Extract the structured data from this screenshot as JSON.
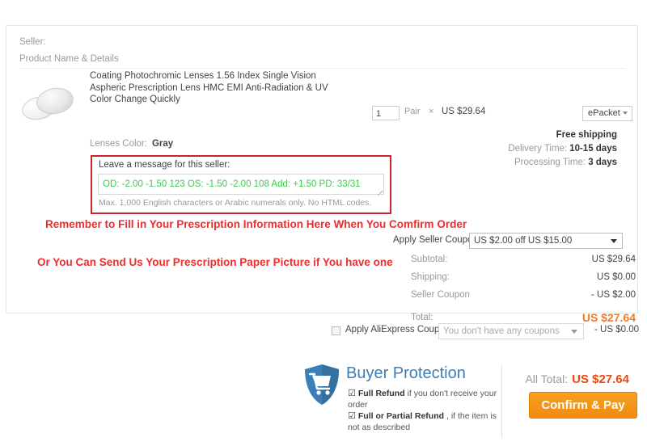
{
  "card": {
    "seller_label": "Seller:",
    "product_name_details_label": "Product Name & Details"
  },
  "product": {
    "title": "Coating Photochromic Lenses 1.56 Index Single Vision Aspheric Prescription Lens HMC EMI Anti-Radiation & UV Color Change Quickly",
    "color_label": "Lenses Color:",
    "color_value": "Gray",
    "quantity": "1",
    "unit": "Pair",
    "times_symbol": "×",
    "unit_price": "US $29.64"
  },
  "shipping": {
    "method": "ePacket",
    "free_shipping": "Free shipping",
    "delivery_time_label": "Delivery Time:",
    "delivery_time_value": "10-15 days",
    "processing_time_label": "Processing Time:",
    "processing_time_value": "3 days"
  },
  "message": {
    "label": "Leave a message for this seller:",
    "value": "OD: -2.00  -1.50  123         OS: -1.50  -2.00  108      Add: +1.50  PD: 33/31",
    "hint": "Max. 1,000 English characters or Arabic numerals only. No HTML codes.",
    "text_color": "#3ecb4f",
    "highlight_color": "#cc2229"
  },
  "annotations": {
    "line1": "Remember to Fill in Your Prescription Information Here When You Comfirm Order",
    "line2": "Or You Can Send Us Your Prescription Paper Picture if You have one",
    "color": "#ee2c2c"
  },
  "seller_coupon": {
    "label": "Apply Seller Coupon:",
    "selected": "US $2.00 off US $15.00"
  },
  "totals": {
    "rows": [
      {
        "label": "Subtotal:",
        "value": "US $29.64"
      },
      {
        "label": "Shipping:",
        "value": "US $0.00"
      },
      {
        "label": "Seller Coupon",
        "value": "- US $2.00"
      }
    ],
    "grand_label": "Total:",
    "grand_value": "US $27.64",
    "grand_color": "#f47a20"
  },
  "ali_coupon": {
    "label": "Apply AliExpress Coupon:",
    "selected": "You don't have any coupons",
    "amount": "- US $0.00"
  },
  "buyer_protection": {
    "title": "Buyer Protection",
    "title_color": "#3c7eb8",
    "check_glyph": "☑",
    "item1_strong": "Full Refund",
    "item1_rest": " if you don't receive your order",
    "item2_strong": "Full or Partial Refund",
    "item2_rest": " , if the item is not as described"
  },
  "checkout": {
    "all_total_label": "All Total:",
    "all_total_value": "US $27.64",
    "all_total_color": "#e8490f",
    "pay_button": "Confirm & Pay",
    "pay_button_color": "#f39a16"
  }
}
